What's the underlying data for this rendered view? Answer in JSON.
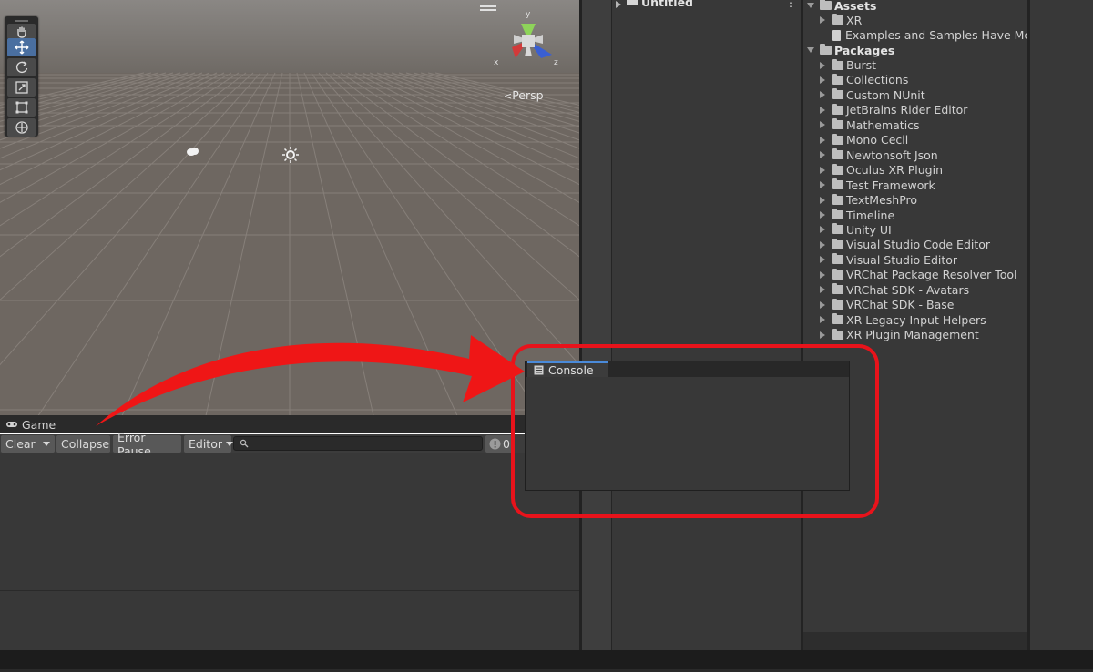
{
  "scene": {
    "view_mode": "Persp",
    "tools": [
      {
        "name": "hand-tool-icon"
      },
      {
        "name": "move-tool-icon",
        "active": true
      },
      {
        "name": "rotate-tool-icon"
      },
      {
        "name": "scale-tool-icon"
      },
      {
        "name": "rect-tool-icon"
      },
      {
        "name": "transform-tool-icon"
      }
    ],
    "gizmo_axes": {
      "x": "x",
      "y": "y",
      "z": "z"
    }
  },
  "game_tab": {
    "label": "Game"
  },
  "console_toolbar": {
    "clear": "Clear",
    "collapse": "Collapse",
    "error_pause": "Error Pause",
    "editor": "Editor",
    "error_count": "0"
  },
  "hierarchy": {
    "scene_name": "Untitled"
  },
  "project": {
    "assets_label": "Assets",
    "assets_items": [
      {
        "label": "XR",
        "type": "folder"
      },
      {
        "label": "Examples and Samples Have Mov",
        "type": "file"
      }
    ],
    "packages_label": "Packages",
    "packages_items": [
      "Burst",
      "Collections",
      "Custom NUnit",
      "JetBrains Rider Editor",
      "Mathematics",
      "Mono Cecil",
      "Newtonsoft Json",
      "Oculus XR Plugin",
      "Test Framework",
      "TextMeshPro",
      "Timeline",
      "Unity UI",
      "Visual Studio Code Editor",
      "Visual Studio Editor",
      "VRChat Package Resolver Tool",
      "VRChat SDK - Avatars",
      "VRChat SDK - Base",
      "XR Legacy Input Helpers",
      "XR Plugin Management"
    ]
  },
  "console_window": {
    "tab_label": "Console"
  },
  "colors": {
    "callout": "#e8131b",
    "scene_ground": "#6e6761",
    "panel": "#383838",
    "accent": "#4a8ad9"
  }
}
